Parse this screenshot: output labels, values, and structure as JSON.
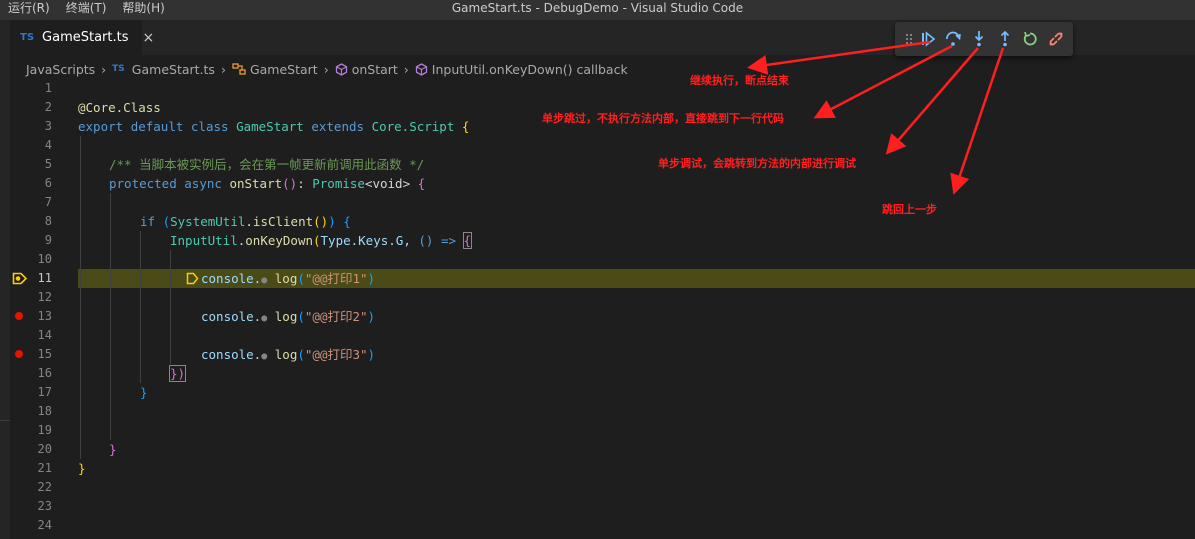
{
  "menu": [
    "运行(R)",
    "终端(T)",
    "帮助(H)"
  ],
  "window_title": "GameStart.ts - DebugDemo - Visual Studio Code",
  "tab": {
    "lang": "TS",
    "name": "GameStart.ts",
    "close": "×"
  },
  "breadcrumb": {
    "folder": "JavaScripts",
    "file_lang": "TS",
    "file": "GameStart.ts",
    "class": "GameStart",
    "method": "onStart",
    "callback": "InputUtil.onKeyDown() callback"
  },
  "toolbar_icons": [
    "drag-handle-icon",
    "continue-icon",
    "step-over-icon",
    "step-into-icon",
    "step-out-icon",
    "restart-icon",
    "disconnect-icon"
  ],
  "line_numbers": [
    "1",
    "2",
    "3",
    "4",
    "5",
    "6",
    "7",
    "8",
    "9",
    "10",
    "11",
    "12",
    "13",
    "14",
    "15",
    "16",
    "17",
    "18",
    "19",
    "20",
    "21",
    "22",
    "23",
    "24"
  ],
  "active_line": "11",
  "breakpoint_lines": [
    "13",
    "15"
  ],
  "code": {
    "l2": {
      "decorator": "@Core.Class"
    },
    "l3": {
      "export": "export",
      "default": "default",
      "class": "class",
      "name": "GameStart",
      "extends": "extends",
      "base": "Core.Script",
      "brace": "{"
    },
    "l5": {
      "comment": "/** 当脚本被实例后，会在第一帧更新前调用此函数 */"
    },
    "l6": {
      "protected": "protected",
      "async": "async",
      "fn": "onStart",
      "paren": "()",
      "colon": ":",
      "type": "Promise",
      "generic": "<void>",
      "brace": "{"
    },
    "l8": {
      "if": "if",
      "open": "(",
      "obj": "SystemUtil",
      "dot": ".",
      "fn": "isClient",
      "call": "()",
      "close": ")",
      "brace": "{"
    },
    "l9": {
      "obj": "InputUtil",
      "dot": ".",
      "fn": "onKeyDown",
      "open": "(",
      "args": "Type.Keys.G, ",
      "arrow": "() =>",
      "brace": "{"
    },
    "l11": {
      "obj": "console.",
      "fn": "log",
      "open": "(",
      "str": "\"@@打印1\"",
      "close": ")"
    },
    "l13": {
      "obj": "console.",
      "fn": "log",
      "open": "(",
      "str": "\"@@打印2\"",
      "close": ")"
    },
    "l15": {
      "obj": "console.",
      "fn": "log",
      "open": "(",
      "str": "\"@@打印3\"",
      "close": ")"
    },
    "l16": {
      "text": "})"
    },
    "l17": {
      "text": "}"
    },
    "l20": {
      "text": "}"
    },
    "l21": {
      "text": "}"
    }
  },
  "annotations": {
    "continue": "继续执行，断点结束",
    "step_over": "单步跳过，不执行方法内部，直接跳到下一行代码",
    "step_into": "单步调试，会跳转到方法的内部进行调试",
    "step_out": "跳回上一步"
  },
  "colors": {
    "annotation": "#ff1f1f",
    "current_line": "#4b4b18",
    "breakpoint": "#e51400",
    "debug_icon": "#75beff"
  }
}
